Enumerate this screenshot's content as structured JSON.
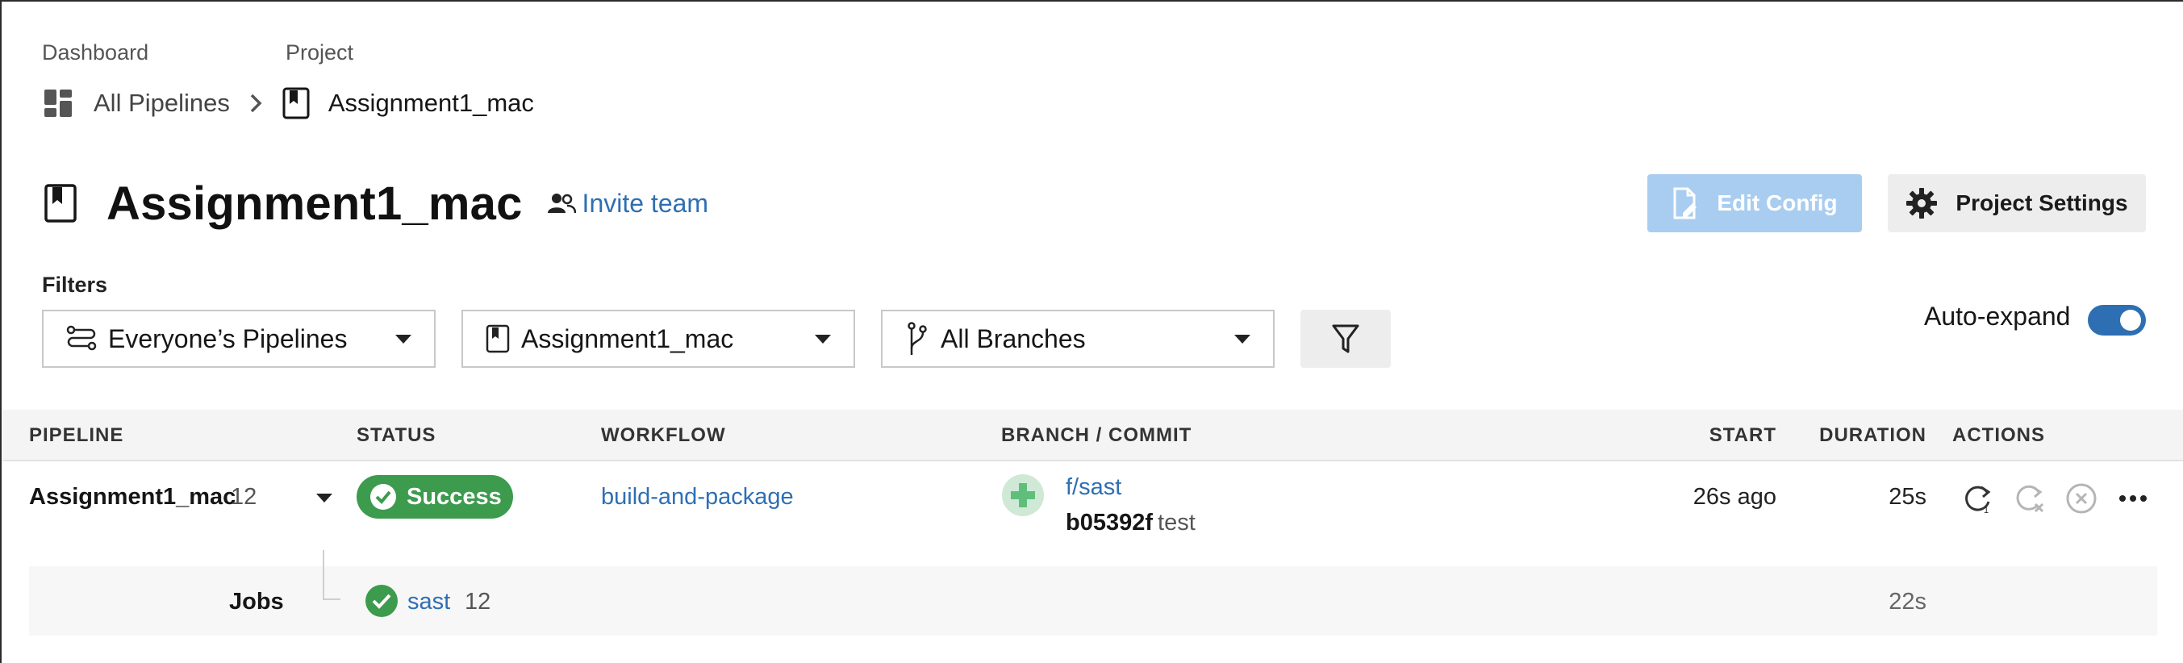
{
  "breadcrumb": {
    "dashboard_label": "Dashboard",
    "project_label": "Project",
    "all_pipelines": "All Pipelines",
    "current_project": "Assignment1_mac"
  },
  "header": {
    "title": "Assignment1_mac",
    "invite_label": "Invite team",
    "edit_config_label": "Edit Config",
    "project_settings_label": "Project Settings"
  },
  "filters": {
    "label": "Filters",
    "pipelines_select": "Everyone’s Pipelines",
    "project_select": "Assignment1_mac",
    "branch_select": "All Branches",
    "auto_expand_label": "Auto-expand",
    "auto_expand_on": true
  },
  "table": {
    "columns": {
      "pipeline": "PIPELINE",
      "status": "STATUS",
      "workflow": "WORKFLOW",
      "branch_commit": "BRANCH / COMMIT",
      "start": "START",
      "duration": "DURATION",
      "actions": "ACTIONS"
    },
    "rows": [
      {
        "pipeline": "Assignment1_mac",
        "number": "12",
        "status": "Success",
        "workflow": "build-and-package",
        "branch": "f/sast",
        "commit_hash": "b05392f",
        "commit_message": "test",
        "start": "26s ago",
        "duration": "25s",
        "jobs": {
          "label": "Jobs",
          "items": [
            {
              "name": "sast",
              "number": "12",
              "duration": "22s"
            }
          ]
        }
      }
    ]
  },
  "colors": {
    "accent": "#2e6fb3",
    "success": "#3c9b4d",
    "edit_config_disabled": "#a9cdf0"
  },
  "icons": {
    "dashboard": "dashboard-icon",
    "project": "project-bookmark-icon",
    "invite": "people-icon",
    "edit_config": "file-edit-icon",
    "settings": "gear-icon",
    "pipelines_filter": "pipelines-icon",
    "branch": "git-branch-icon",
    "filter": "funnel-icon",
    "rerun": "rerun-icon",
    "rerun_failed": "rerun-failed-icon",
    "cancel": "cancel-icon",
    "more": "more-horizontal-icon"
  }
}
